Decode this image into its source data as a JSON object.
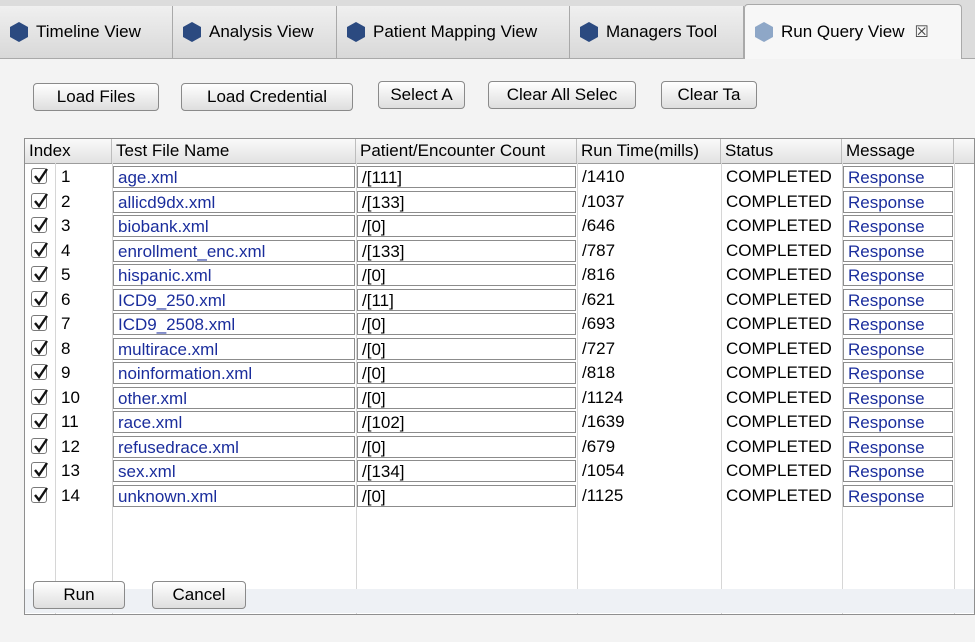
{
  "tabs": [
    {
      "label": "Timeline View"
    },
    {
      "label": "Analysis View"
    },
    {
      "label": "Patient Mapping View"
    },
    {
      "label": "Managers Tool"
    },
    {
      "label": "Run Query View",
      "close": "☒"
    }
  ],
  "toolbar": {
    "load_files": "Load Files",
    "load_credential": "Load Credential",
    "select_all": "Select A",
    "clear_all_selected": "Clear All Selec",
    "clear_table": "Clear Ta"
  },
  "table": {
    "columns": [
      "Index",
      "Test File Name",
      "Patient/Encounter Count",
      "Run Time(mills)",
      "Status",
      "Message"
    ],
    "rows": [
      {
        "checked": true,
        "index": "1",
        "file": "age.xml",
        "count": "/[111]",
        "time": "/1410",
        "status": "COMPLETED",
        "message": "Response"
      },
      {
        "checked": true,
        "index": "2",
        "file": "allicd9dx.xml",
        "count": "/[133]",
        "time": "/1037",
        "status": "COMPLETED",
        "message": "Response"
      },
      {
        "checked": true,
        "index": "3",
        "file": "biobank.xml",
        "count": "/[0]",
        "time": "/646",
        "status": "COMPLETED",
        "message": "Response"
      },
      {
        "checked": true,
        "index": "4",
        "file": "enrollment_enc.xml",
        "count": "/[133]",
        "time": "/787",
        "status": "COMPLETED",
        "message": "Response"
      },
      {
        "checked": true,
        "index": "5",
        "file": "hispanic.xml",
        "count": "/[0]",
        "time": "/816",
        "status": "COMPLETED",
        "message": "Response"
      },
      {
        "checked": true,
        "index": "6",
        "file": "ICD9_250.xml",
        "count": "/[11]",
        "time": "/621",
        "status": "COMPLETED",
        "message": "Response"
      },
      {
        "checked": true,
        "index": "7",
        "file": "ICD9_2508.xml",
        "count": "/[0]",
        "time": "/693",
        "status": "COMPLETED",
        "message": "Response"
      },
      {
        "checked": true,
        "index": "8",
        "file": "multirace.xml",
        "count": "/[0]",
        "time": "/727",
        "status": "COMPLETED",
        "message": "Response"
      },
      {
        "checked": true,
        "index": "9",
        "file": "noinformation.xml",
        "count": "/[0]",
        "time": "/818",
        "status": "COMPLETED",
        "message": "Response"
      },
      {
        "checked": true,
        "index": "10",
        "file": "other.xml",
        "count": "/[0]",
        "time": "/1124",
        "status": "COMPLETED",
        "message": "Response"
      },
      {
        "checked": true,
        "index": "11",
        "file": "race.xml",
        "count": "/[102]",
        "time": "/1639",
        "status": "COMPLETED",
        "message": "Response"
      },
      {
        "checked": true,
        "index": "12",
        "file": "refusedrace.xml",
        "count": "/[0]",
        "time": "/679",
        "status": "COMPLETED",
        "message": "Response"
      },
      {
        "checked": true,
        "index": "13",
        "file": "sex.xml",
        "count": "/[134]",
        "time": "/1054",
        "status": "COMPLETED",
        "message": "Response"
      },
      {
        "checked": true,
        "index": "14",
        "file": "unknown.xml",
        "count": "/[0]",
        "time": "/1125",
        "status": "COMPLETED",
        "message": "Response"
      }
    ]
  },
  "footer": {
    "run": "Run",
    "cancel": "Cancel"
  },
  "colors": {
    "tab_icon": "#2b4a80",
    "tab_icon_active": "#8ea7c7",
    "link": "#1a2d9c"
  },
  "icons": {
    "tab_icon": "hexagon-icon",
    "close": "close-icon",
    "checkbox": "checkbox-checked-icon"
  }
}
